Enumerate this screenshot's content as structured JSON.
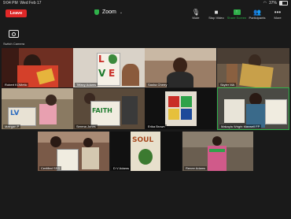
{
  "status": {
    "time": "9:04 PM",
    "date": "Wed Feb 17",
    "battery": "37%",
    "battery_level": 0.37
  },
  "topbar": {
    "leave": "Leave",
    "title": "Zoom",
    "chevron": "⌄"
  },
  "tools": [
    {
      "label": "Mute",
      "icon": "microphone-icon"
    },
    {
      "label": "Stop Video",
      "icon": "video-camera-icon"
    },
    {
      "label": "Share Screen",
      "icon": "share-screen-icon"
    },
    {
      "label": "Participants",
      "icon": "participants-icon"
    },
    {
      "label": "More",
      "icon": "more-icon"
    }
  ],
  "switch_camera": "Switch Camera",
  "participants": [
    {
      "name": "Robert KOMetic"
    },
    {
      "name": "Tiffany Adams"
    },
    {
      "name": "Sasha Cherry"
    },
    {
      "name": "Skyler MA"
    },
    {
      "name": "Maegan P"
    },
    {
      "name": "Serena Jones"
    },
    {
      "name": "Erika Brown"
    },
    {
      "name": "Makayla Wright Maxwell FP"
    },
    {
      "name": "Certified SSS"
    },
    {
      "name": "D V Adams"
    },
    {
      "name": ""
    },
    {
      "name": "Renee Adams"
    }
  ],
  "art": {
    "love": [
      "L",
      "O",
      "V",
      "E"
    ],
    "faith": "FAITH",
    "soul": "SOUL",
    "hope": "HOPE"
  }
}
